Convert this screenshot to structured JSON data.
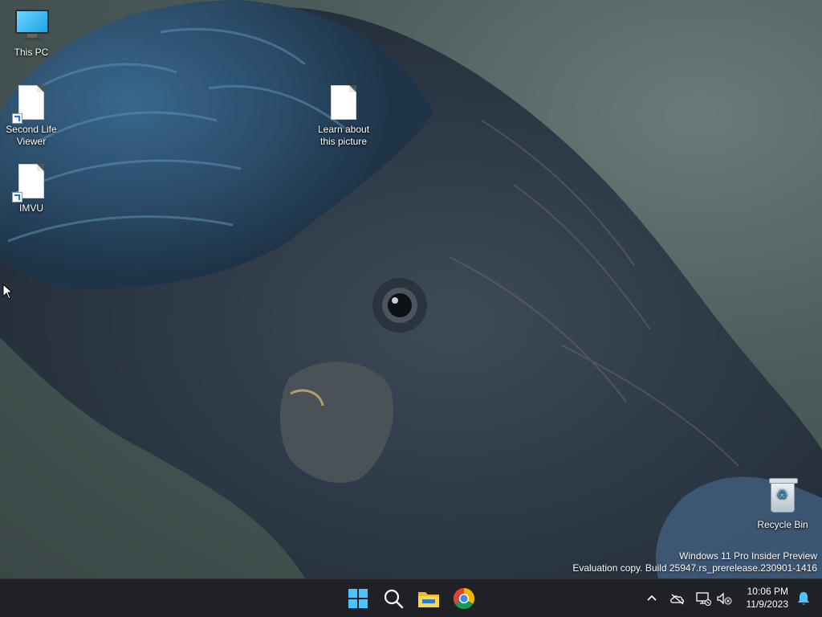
{
  "desktop": {
    "icons": [
      {
        "label": "This PC",
        "icon": "monitor-icon"
      },
      {
        "label": "Second Life Viewer",
        "label_line1": "Second Life",
        "label_line2": "Viewer",
        "icon": "file-shortcut-icon"
      },
      {
        "label": "Learn about this picture",
        "label_line1": "Learn about",
        "label_line2": "this picture",
        "icon": "file-icon"
      },
      {
        "label": "IMVU",
        "icon": "file-shortcut-icon"
      },
      {
        "label": "Recycle Bin",
        "icon": "recycle-bin-icon"
      }
    ],
    "wallpaper": "black-cockatoo-photo"
  },
  "watermark": {
    "line1": "Windows 11 Pro Insider Preview",
    "line2": "Evaluation copy. Build 25947.rs_prerelease.230901-1416"
  },
  "taskbar": {
    "pinned": [
      {
        "name": "Start",
        "icon": "windows-logo-icon"
      },
      {
        "name": "Search",
        "icon": "search-icon"
      },
      {
        "name": "File Explorer",
        "icon": "folder-icon"
      },
      {
        "name": "Google Chrome",
        "icon": "chrome-icon"
      }
    ],
    "tray": [
      {
        "name": "Show hidden icons",
        "icon": "chevron-up-icon"
      },
      {
        "name": "OneDrive",
        "icon": "cloud-off-icon"
      },
      {
        "name": "Network",
        "icon": "network-icon"
      },
      {
        "name": "Volume",
        "icon": "volume-muted-icon"
      }
    ],
    "clock": {
      "time": "10:06 PM",
      "date": "11/9/2023"
    },
    "notifications_icon": "bell-icon"
  },
  "colors": {
    "taskbar_bg": "#1f2126",
    "accent": "#4cc2ff",
    "notification": "#4cc2ff"
  }
}
